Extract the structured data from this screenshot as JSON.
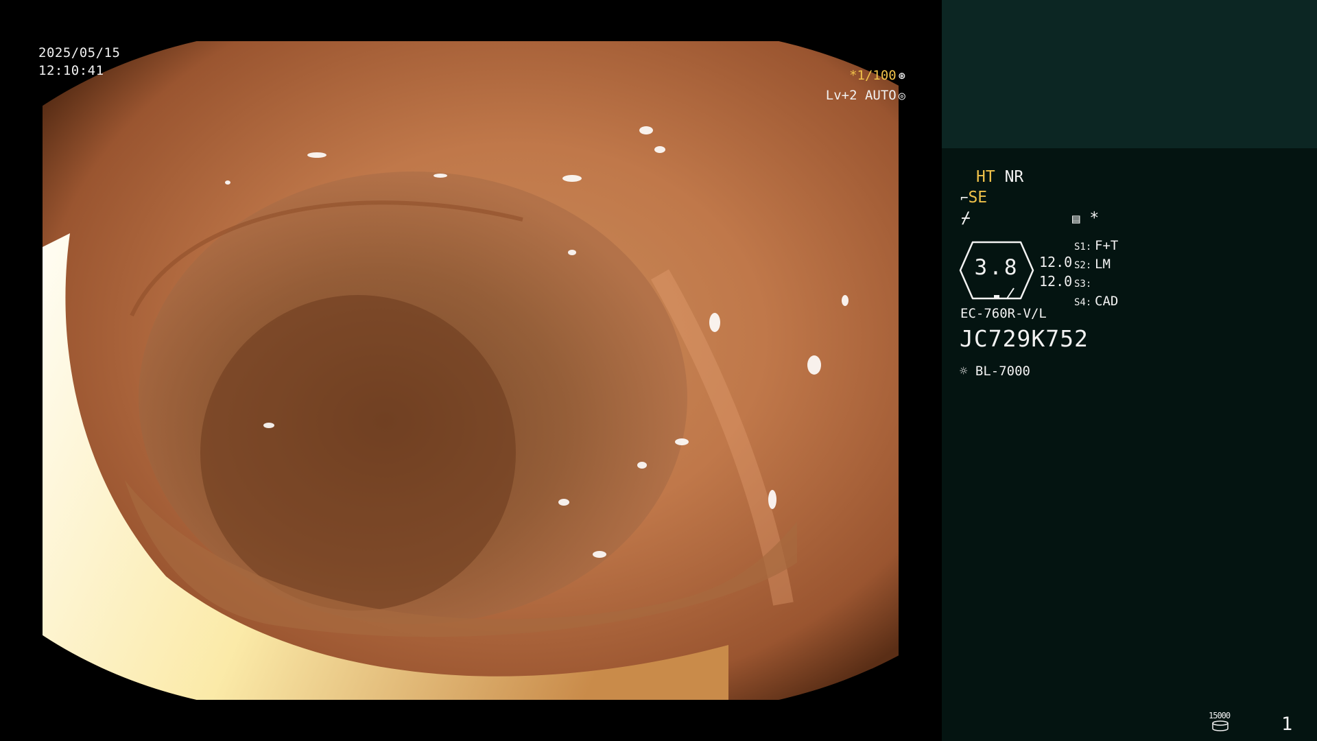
{
  "overlay": {
    "date": "2025/05/15",
    "time": "12:10:41",
    "shutter": "*1/100",
    "shutter_icon": "aperture-icon",
    "mode": "Lv+2 AUTO",
    "mode_icon": "iris-icon"
  },
  "panel": {
    "ht": "HT",
    "nr": "NR",
    "se": "SE",
    "freeze_icon": "freeze-icon",
    "memo_icon": "memo-icon",
    "star": "*",
    "gauge_value": "3.8",
    "num1": "12.0",
    "num2": "12.0",
    "switches": [
      {
        "key": "S1:",
        "value": "F+T"
      },
      {
        "key": "S2:",
        "value": "LM"
      },
      {
        "key": "S3:",
        "value": ""
      },
      {
        "key": "S4:",
        "value": "CAD"
      }
    ],
    "model": "EC-760R-V/L",
    "serial": "JC729K752",
    "light": "BL-7000",
    "light_icon": "light-source-icon",
    "counter": "15000",
    "frame": "1"
  },
  "colors": {
    "panel_bg": "#041411",
    "panel_top_bg": "#0c2623",
    "accent_yellow": "#f0c24a"
  }
}
